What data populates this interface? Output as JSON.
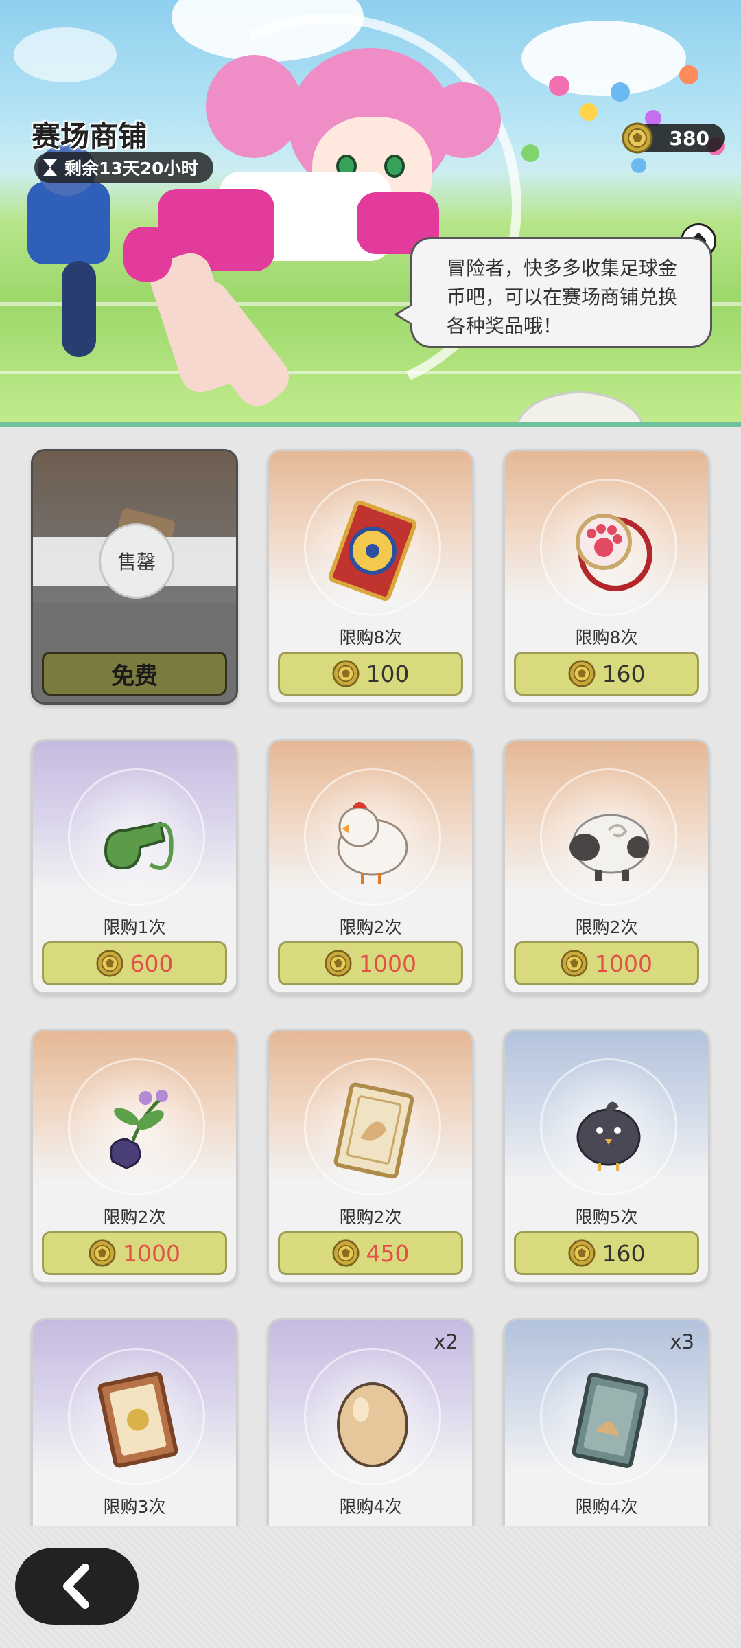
{
  "header": {
    "title": "赛场商铺",
    "timer": "剩余13天20小时",
    "currency_amount": "380",
    "speech": "冒险者，快多多收集足球金币吧，可以在赛场商铺兑换各种奖品哦！"
  },
  "colors": {
    "price_bg": "#d9da7d",
    "price_red": "#e2504a",
    "free_bg": "#7b7a3f",
    "card_orange": "#e5b895",
    "card_purple": "#c5bbe0",
    "card_blue": "#b3c3dc"
  },
  "items": [
    {
      "icon": "ticket-icon",
      "sold_label": "售罄",
      "price": "免费",
      "status": "sold-out"
    },
    {
      "icon": "lottery-ticket-icon",
      "limit": "限购8次",
      "price": "100"
    },
    {
      "icon": "paw-charm-icon",
      "limit": "限购8次",
      "price": "160"
    },
    {
      "icon": "whistle-icon",
      "limit": "限购1次",
      "price": "600"
    },
    {
      "icon": "chicken-icon",
      "limit": "限购2次",
      "price": "1000"
    },
    {
      "icon": "sheep-icon",
      "limit": "限购2次",
      "price": "1000"
    },
    {
      "icon": "flower-bag-icon",
      "limit": "限购2次",
      "price": "1000"
    },
    {
      "icon": "book-icon",
      "limit": "限购2次",
      "price": "450"
    },
    {
      "icon": "black-bird-icon",
      "limit": "限购5次",
      "price": "160"
    },
    {
      "icon": "recipe-book-icon",
      "limit": "限购3次"
    },
    {
      "icon": "egg-icon",
      "limit": "限购4次",
      "multiplier": "x2"
    },
    {
      "icon": "card-pack-icon",
      "limit": "限购4次",
      "multiplier": "x3"
    }
  ]
}
